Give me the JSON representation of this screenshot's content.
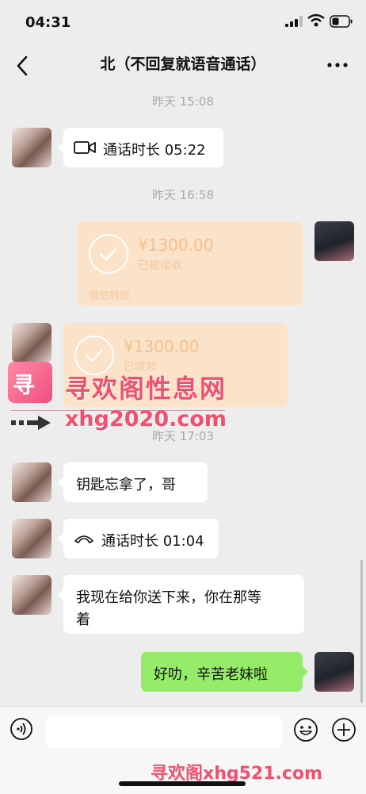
{
  "status": {
    "time": "04:31"
  },
  "nav": {
    "title": "北（不回复就语音通话）"
  },
  "messages": {
    "stamp1": "昨天 15:08",
    "call1": "通话时长 05:22",
    "stamp2": "昨天 16:58",
    "transfer1": {
      "amount": "¥1300.00",
      "status": "已被接收",
      "footer": "微信转账"
    },
    "transfer2": {
      "amount": "¥1300.00",
      "status": "已收款"
    },
    "stamp3": "昨天 17:03",
    "text1": "钥匙忘拿了，哥",
    "call2": "通话时长 01:04",
    "text2_line1": "我现在给你送下来，你在那等",
    "text2_line2": "着",
    "text3": "好叻，辛苦老妹啦"
  },
  "watermark": {
    "line1": "寻欢阁性息网",
    "line2": "xhg2020.com",
    "bottom": "寻欢阁xhg521.com"
  },
  "colors": {
    "green": "#95ec69",
    "transfer": "#fae3c9",
    "watermark": "#f0506e"
  }
}
